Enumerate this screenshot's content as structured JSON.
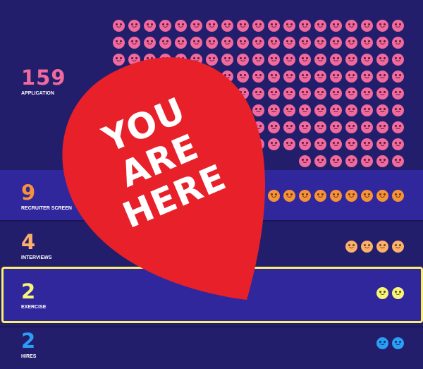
{
  "stages": [
    {
      "count": "159",
      "name": "APPLICATION",
      "color": "#f06a9e",
      "smiley_count": 159
    },
    {
      "count": "9",
      "name": "RECRUITER SCREEN",
      "color": "#f5923a",
      "smiley_count": 9
    },
    {
      "count": "4",
      "name": "INTERVIEWS",
      "color": "#fbb16c",
      "smiley_count": 4
    },
    {
      "count": "2",
      "name": "EXERCISE",
      "color": "#f6f47a",
      "smiley_count": 2
    },
    {
      "count": "2",
      "name": "HIRES",
      "color": "#2a9df5",
      "smiley_count": 2
    }
  ],
  "marker": {
    "lines": [
      "YOU",
      "ARE",
      "HERE"
    ],
    "color": "#e8202a",
    "current_stage": "EXERCISE"
  },
  "icons": {
    "smiley": "smiley-face-icon",
    "marker": "map-pin-icon"
  }
}
